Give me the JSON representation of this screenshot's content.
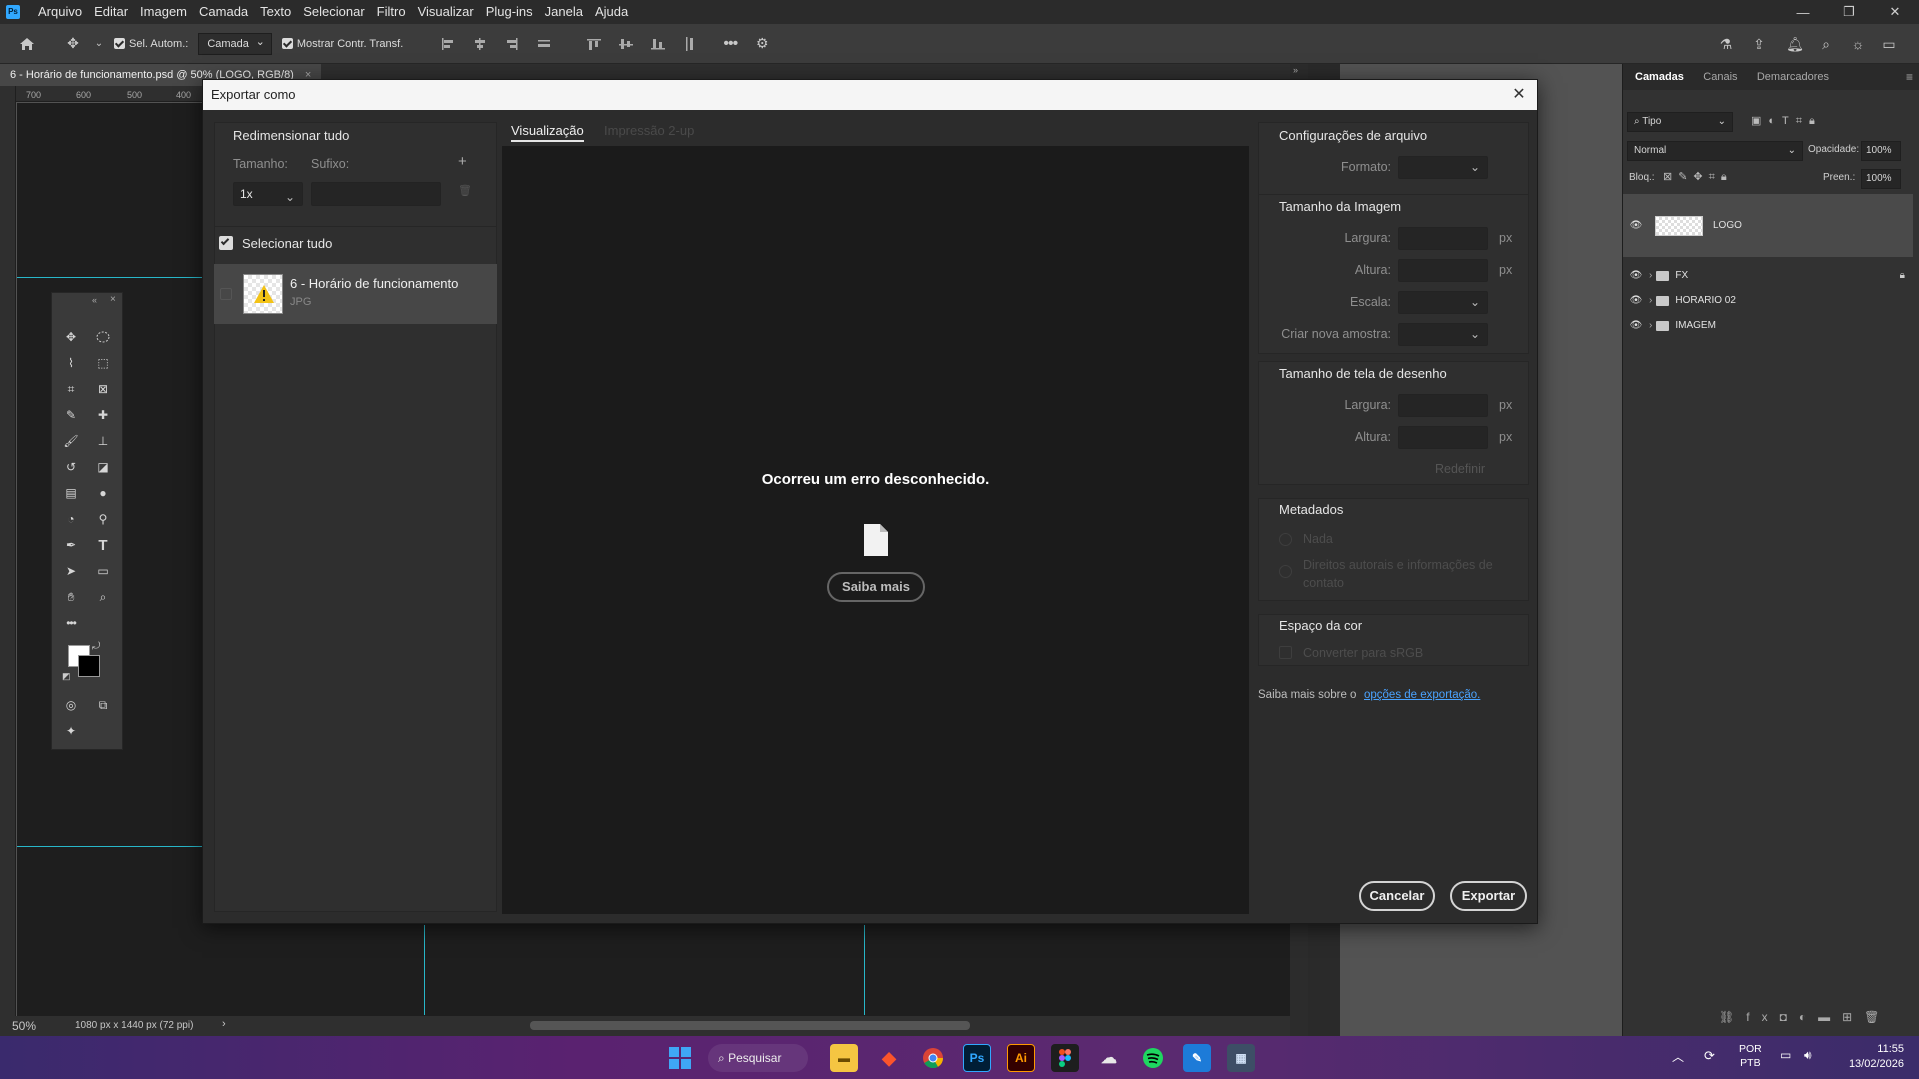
{
  "menu": [
    "Arquivo",
    "Editar",
    "Imagem",
    "Camada",
    "Texto",
    "Selecionar",
    "Filtro",
    "Visualizar",
    "Plug-ins",
    "Janela",
    "Ajuda"
  ],
  "options_bar": {
    "auto_select_label": "Sel. Autom.:",
    "auto_select_value": "Camada",
    "show_transform_label": "Mostrar Contr. Transf."
  },
  "document_tab": "6 - Horário de funcionamento.psd @ 50% (LOGO, RGB/8)",
  "ruler": {
    "top": [
      "700",
      "600",
      "500",
      "400"
    ]
  },
  "status_bar": {
    "zoom": "50%",
    "doc_info": "1080 px x 1440 px (72 ppi)"
  },
  "layers_panel": {
    "tabs": [
      "Camadas",
      "Canais",
      "Demarcadores"
    ],
    "filter": "Tipo",
    "blend_mode": "Normal",
    "opacity_label": "Opacidade:",
    "opacity_value": "100%",
    "lock_label": "Bloq.:",
    "fill_label": "Preen.:",
    "fill_value": "100%",
    "layers": [
      {
        "name": "LOGO"
      },
      {
        "name": "FX"
      },
      {
        "name": "HORARIO 02"
      },
      {
        "name": "IMAGEM"
      }
    ]
  },
  "dialog": {
    "title": "Exportar como",
    "left": {
      "resize_title": "Redimensionar tudo",
      "size_label": "Tamanho:",
      "suffix_label": "Sufixo:",
      "size_value": "1x",
      "select_all": "Selecionar tudo",
      "asset_name": "6 - Horário de funcionamento",
      "asset_format": "JPG"
    },
    "preview": {
      "tabs": [
        "Visualização",
        "Impressão 2-up"
      ],
      "error": "Ocorreu um erro desconhecido.",
      "learn_more": "Saiba mais"
    },
    "right": {
      "file_settings_title": "Configurações de arquivo",
      "format_label": "Formato:",
      "image_size_title": "Tamanho da Imagem",
      "width_label": "Largura:",
      "height_label": "Altura:",
      "scale_label": "Escala:",
      "resample_label": "Criar nova amostra:",
      "unit_px": "px",
      "canvas_size_title": "Tamanho de tela de desenho",
      "reset": "Redefinir",
      "metadata_title": "Metadados",
      "metadata_none": "Nada",
      "metadata_copyright": "Direitos autorais e informações de contato",
      "color_space_title": "Espaço da cor",
      "convert_srgb": "Converter para sRGB",
      "learn_prefix": "Saiba mais sobre o",
      "learn_link": "opções de exportação."
    },
    "buttons": {
      "cancel": "Cancelar",
      "export": "Exportar"
    }
  },
  "taskbar": {
    "search": "Pesquisar",
    "lang_line1": "POR",
    "lang_line2": "PTB",
    "time": "11:55",
    "date": "13/02/2026"
  },
  "colors": {
    "accent": "#31a8ff",
    "link": "#4aa3ff",
    "guide": "#28b7c9",
    "warning": "#f3c316"
  }
}
